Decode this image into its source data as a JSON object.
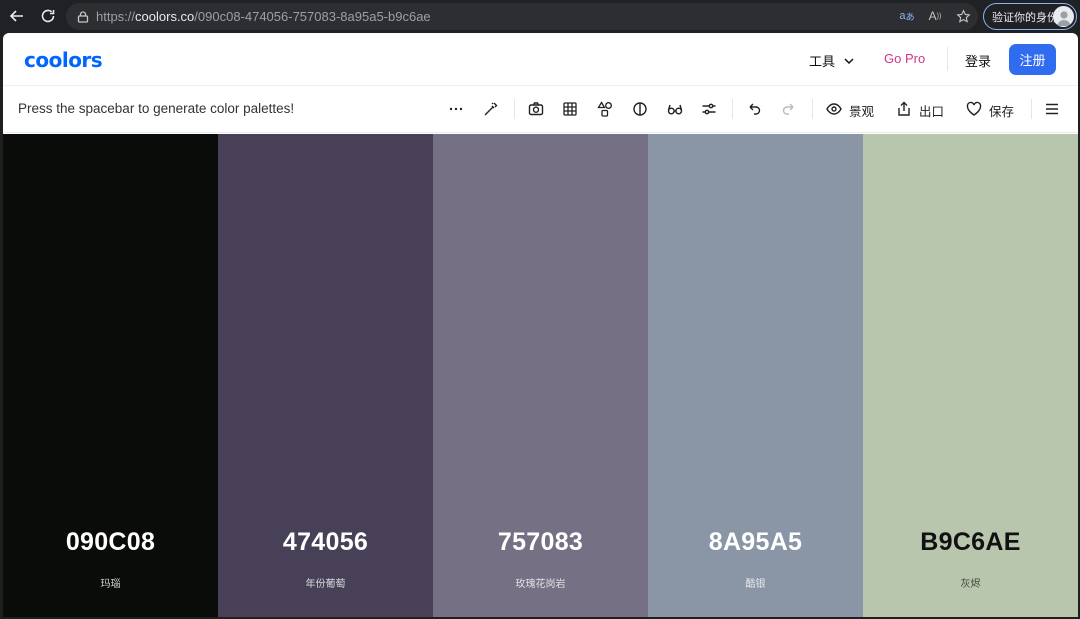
{
  "browser": {
    "url_scheme": "https://",
    "url_host": "coolors.co",
    "url_path": "/090c08-474056-757083-8a95a5-b9c6ae",
    "verify_label": "验证你的身份"
  },
  "header": {
    "logo": "coolors",
    "tools_label": "工具",
    "gopro_label": "Go Pro",
    "login_label": "登录",
    "signup_label": "注册",
    "accent": "#2f6cf0",
    "gopro_color": "#d1368a"
  },
  "toolbar": {
    "hint": "Press the spacebar to generate color palettes!",
    "view_label": "景观",
    "export_label": "出口",
    "save_label": "保存"
  },
  "palette": [
    {
      "hex": "090C08",
      "name": "玛瑙",
      "color": "#090c08",
      "text": "#ffffff"
    },
    {
      "hex": "474056",
      "name": "年份葡萄",
      "color": "#474056",
      "text": "#ffffff"
    },
    {
      "hex": "757083",
      "name": "玫瑰花岗岩",
      "color": "#757083",
      "text": "#ffffff"
    },
    {
      "hex": "8A95A5",
      "name": "酷银",
      "color": "#8a95a5",
      "text": "#ffffff"
    },
    {
      "hex": "B9C6AE",
      "name": "灰烬",
      "color": "#b9c6ae",
      "text": "#111111"
    }
  ]
}
